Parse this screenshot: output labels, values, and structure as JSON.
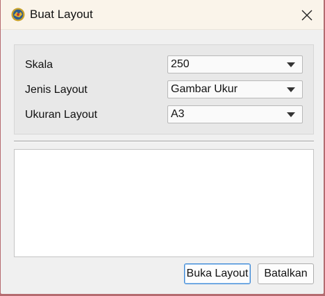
{
  "window": {
    "title": "Buat Layout",
    "icon": "app-logo-icon",
    "close_icon": "close-icon"
  },
  "form": {
    "fields": [
      {
        "label": "Skala",
        "value": "250"
      },
      {
        "label": "Jenis Layout",
        "value": "Gambar Ukur"
      },
      {
        "label": "Ukuran Layout",
        "value": "A3"
      }
    ]
  },
  "output": {
    "text": ""
  },
  "buttons": {
    "open_label": "Buka Layout",
    "cancel_label": "Batalkan"
  },
  "colors": {
    "accent": "#3b87d6",
    "titlebar": "#faf4ea",
    "dialog_bg": "#f0f0f0",
    "backdrop": "#b56b70"
  }
}
